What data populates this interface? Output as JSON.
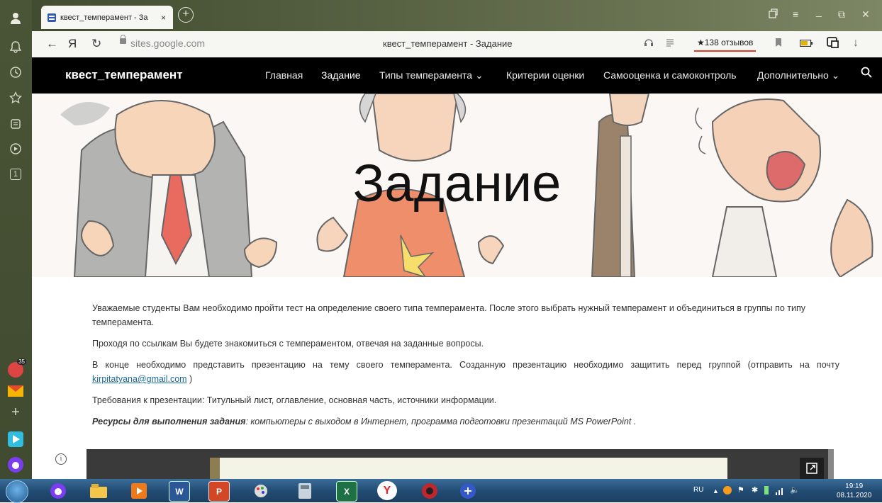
{
  "browser": {
    "tab_title": "квест_темперамент - За",
    "tab_close": "×",
    "new_tab": "+",
    "back": "←",
    "yandex": "Я",
    "reload": "↻",
    "url": "sites.google.com",
    "page_title": "квест_темперамент - Задание",
    "reviews": "★138 отзывов",
    "download": "↓",
    "window_controls": {
      "menu": "≡",
      "minimize": "_",
      "restore": "⧉",
      "close": "✕"
    }
  },
  "site": {
    "name": "квест_темперамент",
    "nav": [
      {
        "label": "Главная",
        "active": false
      },
      {
        "label": "Задание",
        "active": true
      },
      {
        "label": "Типы темперамента ⌄",
        "active": false
      },
      {
        "label": "Критерии оценки",
        "active": false
      },
      {
        "label": "Самооценка и самоконтроль",
        "active": false
      },
      {
        "label": "Дополнительно ⌄",
        "active": false
      }
    ],
    "search_icon": "search-icon",
    "banner_title": "Задание"
  },
  "content": {
    "p1": "Уважаемые студенты Вам необходимо пройти тест на определение своего типа темперамента. После этого выбрать нужный темперамент и объединиться в группы по типу темперамента.",
    "p2": "Проходя по ссылкам Вы будете знакомиться с темпераментом, отвечая на заданные вопросы.",
    "p3": "В конце необходимо представить презентацию на тему своего темперамента. Созданную презентацию необходимо защитить перед группой (отправить на почту ",
    "p3_email": "kirpitatyana@gmail.com",
    "p3_end": " )",
    "p4": "Требования к презентации: Титульный лист, оглавление, основная часть, источники информации.",
    "p5_bold": "Ресурсы для выполнения задания",
    "p5_rest": ": компьютеры с выходом в Интернет, программа подготовки презентаций MS PowerPoint ."
  },
  "taskbar": {
    "lang": "RU",
    "time": "19:19",
    "date": "08.11.2020",
    "apps": [
      "yandex-browser-alice",
      "file-explorer",
      "media-player",
      "word",
      "powerpoint",
      "paint",
      "calculator",
      "excel",
      "yandex-browser",
      "app-red",
      "app-blue"
    ]
  },
  "sidepanel": {
    "badge": "35",
    "tab_count": "1",
    "add": "+"
  },
  "colors": {
    "header_bg": "#000000",
    "link": "#1a6a9a",
    "sidepanel": "#4a5436",
    "taskbar": "#234d74"
  }
}
